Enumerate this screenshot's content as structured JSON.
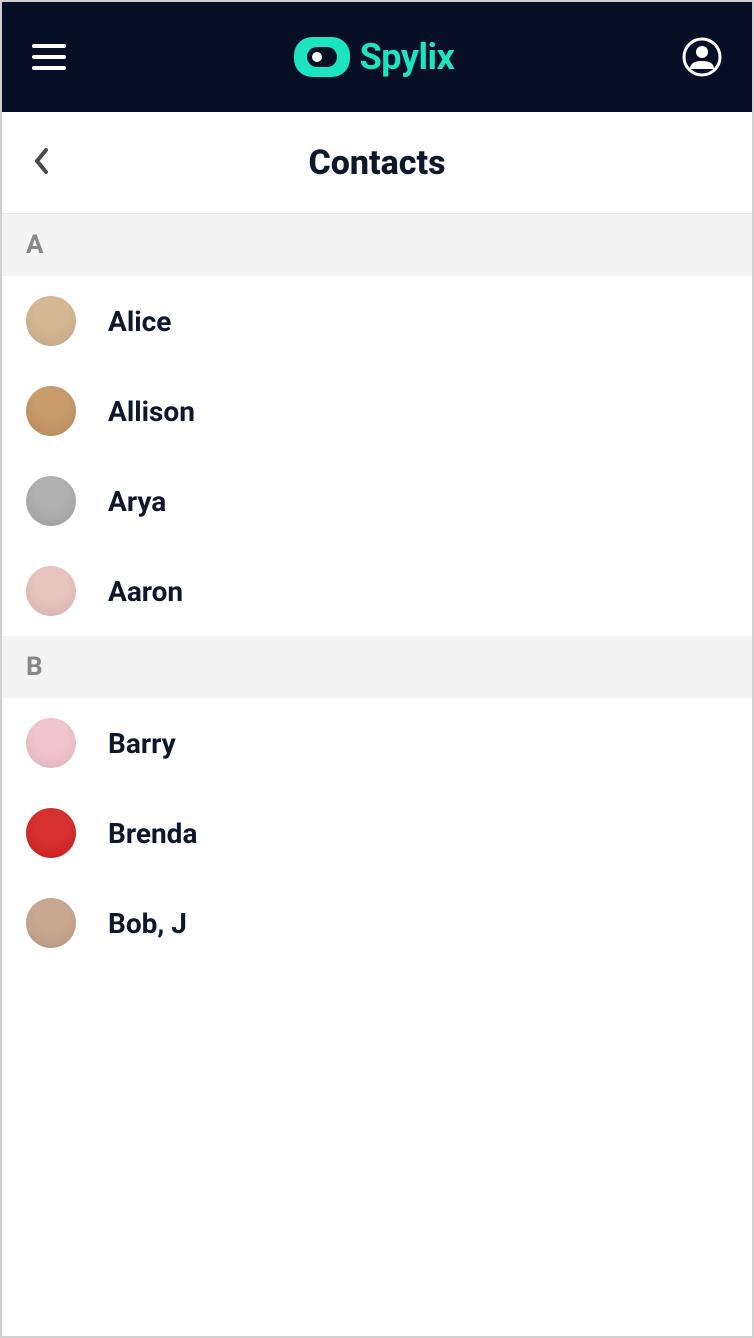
{
  "app": {
    "name": "Spylix"
  },
  "page": {
    "title": "Contacts"
  },
  "sections": [
    {
      "letter": "A",
      "contacts": [
        {
          "name": "Alice",
          "avatarColor": "#d4b896"
        },
        {
          "name": "Allison",
          "avatarColor": "#c99a6b"
        },
        {
          "name": "Arya",
          "avatarColor": "#b0b0b0"
        },
        {
          "name": "Aaron",
          "avatarColor": "#e8c4c0"
        }
      ]
    },
    {
      "letter": "B",
      "contacts": [
        {
          "name": "Barry",
          "avatarColor": "#f0c5d0"
        },
        {
          "name": "Brenda",
          "avatarColor": "#d63030"
        },
        {
          "name": "Bob, J",
          "avatarColor": "#c8a890"
        }
      ]
    }
  ]
}
